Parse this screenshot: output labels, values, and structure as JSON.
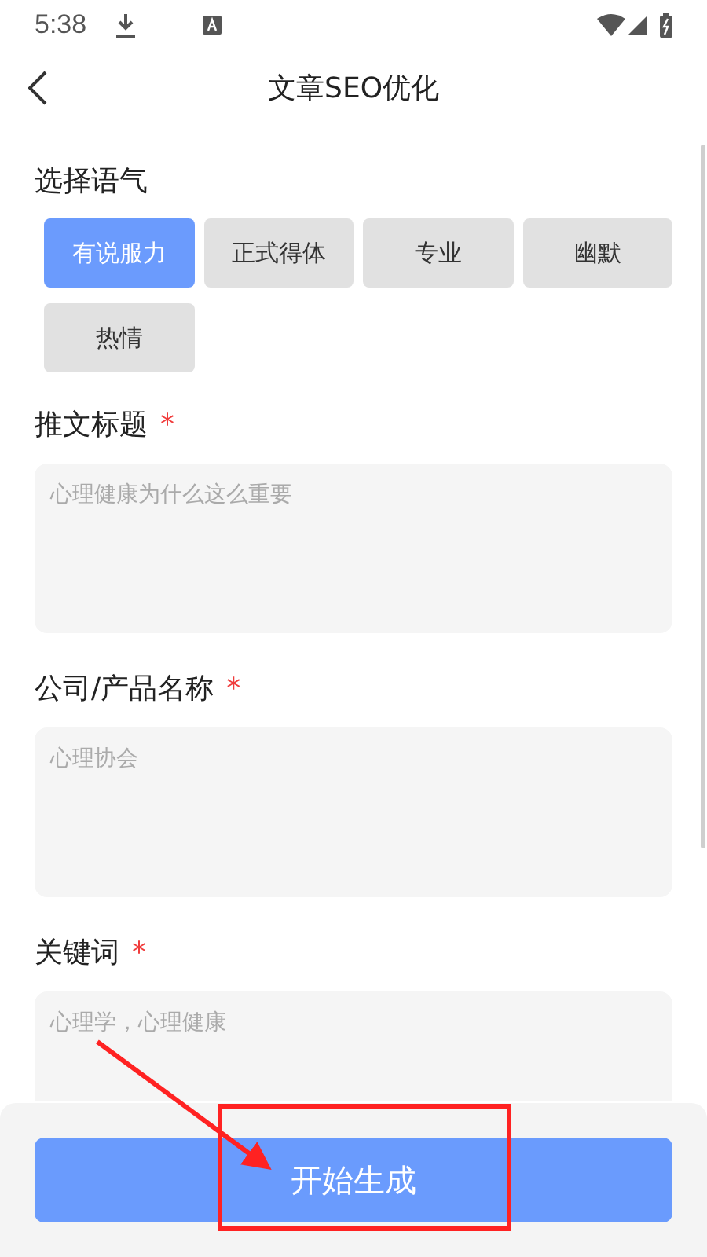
{
  "status_bar": {
    "time": "5:38"
  },
  "header": {
    "title": "文章SEO优化"
  },
  "tone": {
    "label": "选择语气",
    "options": [
      {
        "label": "有说服力",
        "selected": true
      },
      {
        "label": "正式得体",
        "selected": false
      },
      {
        "label": "专业",
        "selected": false
      },
      {
        "label": "幽默",
        "selected": false
      },
      {
        "label": "热情",
        "selected": false
      }
    ]
  },
  "fields": [
    {
      "label": "推文标题",
      "required": true,
      "placeholder": "心理健康为什么这么重要"
    },
    {
      "label": "公司/产品名称",
      "required": true,
      "placeholder": "心理协会"
    },
    {
      "label": "关键词",
      "required": true,
      "placeholder": "心理学，心理健康"
    }
  ],
  "required_mark": "*",
  "generate_button": {
    "label": "开始生成"
  }
}
